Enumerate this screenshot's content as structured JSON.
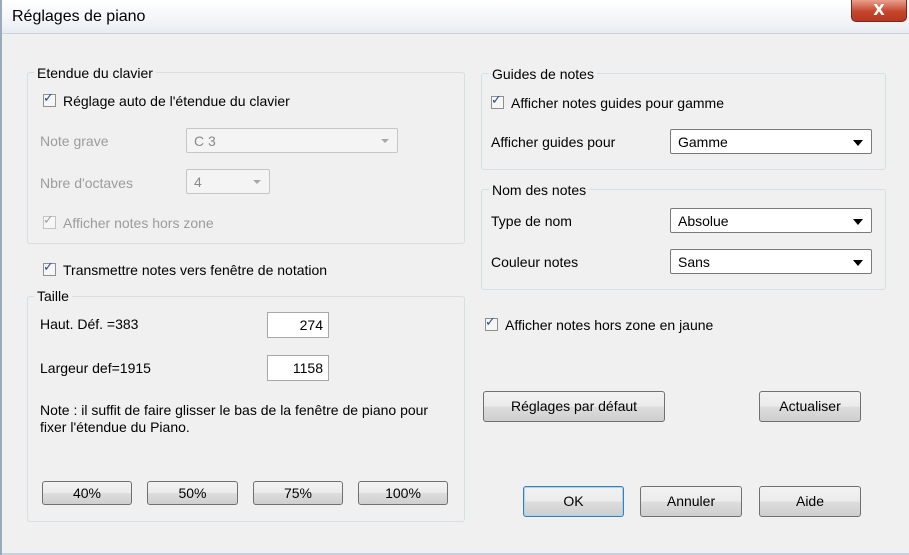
{
  "window": {
    "title": "Réglages de piano",
    "close_label": "X"
  },
  "keyboard_range": {
    "legend": "Etendue du clavier",
    "auto_label": "Réglage auto de l'étendue du clavier",
    "auto_checked": true,
    "low_note_label": "Note grave",
    "low_note_value": "C 3",
    "octaves_label": "Nbre d'octaves",
    "octaves_value": "4",
    "show_out_label": "Afficher notes hors zone",
    "show_out_checked": true
  },
  "send_notation": {
    "label": "Transmettre notes vers fenêtre de notation",
    "checked": true
  },
  "size": {
    "legend": "Taille",
    "height_label": "Haut. Déf. =383",
    "height_value": "274",
    "width_label": "Largeur def=1915",
    "width_value": "1158",
    "note": "Note : il suffit de faire glisser le bas de la fenêtre de piano pour fixer l'étendue du Piano.",
    "buttons": [
      "40%",
      "50%",
      "75%",
      "100%"
    ]
  },
  "note_guides": {
    "legend": "Guides de notes",
    "show_scale_label": "Afficher notes guides pour gamme",
    "show_scale_checked": true,
    "guides_for_label": "Afficher guides pour",
    "guides_for_value": "Gamme"
  },
  "note_names": {
    "legend": "Nom des notes",
    "name_type_label": "Type de nom",
    "name_type_value": "Absolue",
    "color_label": "Couleur notes",
    "color_value": "Sans"
  },
  "yellow_out": {
    "label": "Afficher notes hors zone en jaune",
    "checked": true
  },
  "buttons": {
    "defaults": "Réglages par défaut",
    "refresh": "Actualiser",
    "ok": "OK",
    "cancel": "Annuler",
    "help": "Aide"
  },
  "colors": {
    "accent": "#2b4d8a",
    "close": "#c6452c",
    "frame": "#f0f0f0"
  },
  "icons": {
    "check": "check-mark-icon",
    "dropdown": "chevron-down-icon",
    "close": "close-icon"
  }
}
